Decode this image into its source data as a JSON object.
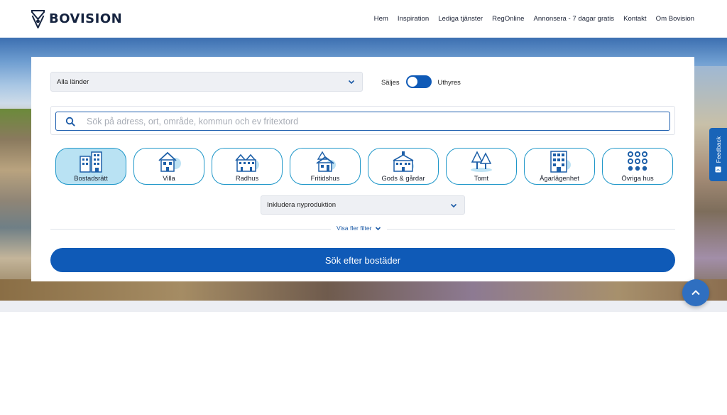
{
  "brand": {
    "name": "BOVISION",
    "color": "#0f5ab7"
  },
  "nav": {
    "items": [
      "Hem",
      "Inspiration",
      "Lediga tjänster",
      "RegOnline",
      "Annonsera - 7 dagar gratis",
      "Kontakt",
      "Om Bovision"
    ]
  },
  "search": {
    "country_select": "Alla länder",
    "toggle": {
      "left_label": "Säljes",
      "right_label": "Uthyres"
    },
    "placeholder": "Sök på adress, ort, område, kommun och ev fritextord",
    "categories": [
      {
        "label": "Bostadsrätt",
        "icon": "apartment-building-icon",
        "selected": true
      },
      {
        "label": "Villa",
        "icon": "villa-icon",
        "selected": false
      },
      {
        "label": "Radhus",
        "icon": "townhouse-icon",
        "selected": false
      },
      {
        "label": "Fritidshus",
        "icon": "cabin-icon",
        "selected": false
      },
      {
        "label": "Gods & gårdar",
        "icon": "manor-icon",
        "selected": false
      },
      {
        "label": "Tomt",
        "icon": "plot-trees-icon",
        "selected": false
      },
      {
        "label": "Ägarlägenhet",
        "icon": "owner-apartment-icon",
        "selected": false
      },
      {
        "label": "Övriga hus",
        "icon": "dots-grid-icon",
        "selected": false
      }
    ],
    "new_production_select": "Inkludera nyproduktion",
    "more_filters": "Visa fler filter",
    "submit": "Sök efter bostäder"
  },
  "feedback": {
    "label": "Feedback"
  }
}
